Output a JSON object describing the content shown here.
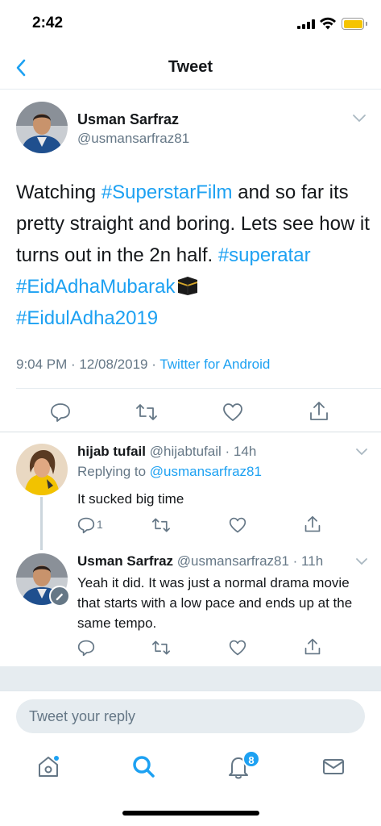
{
  "status_bar": {
    "time": "2:42",
    "battery_color": "#f5c400"
  },
  "header": {
    "title": "Tweet",
    "back_icon": "chevron-left-icon"
  },
  "main_tweet": {
    "author_name": "Usman Sarfraz",
    "author_handle": "@usmansarfraz81",
    "text_parts": {
      "p1": "Watching ",
      "tag1": "#SuperstarFilm",
      "p2": " and so far its pretty straight and boring. Lets see how it turns out in the 2n half. ",
      "tag2": "#superatar",
      "p3": " ",
      "tag3": "#EidAdhaMubarak",
      "emoji": "kaaba-icon",
      "tag4": "#EidulAdha2019"
    },
    "timestamp": "9:04 PM · 12/08/2019 · ",
    "source": "Twitter for Android"
  },
  "replies": [
    {
      "author_name": "hijab tufail",
      "author_handle": "@hijabtufail · 14h",
      "replying_prefix": "Replying to ",
      "replying_to": "@usmansarfraz81",
      "text": "It sucked big time",
      "reply_count": "1"
    },
    {
      "author_name": "Usman Sarfraz",
      "author_handle": "@usmansarfraz81 · 11h",
      "text": "Yeah it did. It was just a normal drama movie that starts with a low pace and ends up at the same tempo."
    }
  ],
  "compose": {
    "placeholder": "Tweet your reply"
  },
  "tabbar": {
    "items": [
      "home-icon",
      "search-icon",
      "notifications-icon",
      "messages-icon"
    ],
    "notification_badge": "8"
  },
  "colors": {
    "accent": "#1da1f2",
    "secondary_text": "#657786",
    "divider": "#e6ecf0"
  }
}
